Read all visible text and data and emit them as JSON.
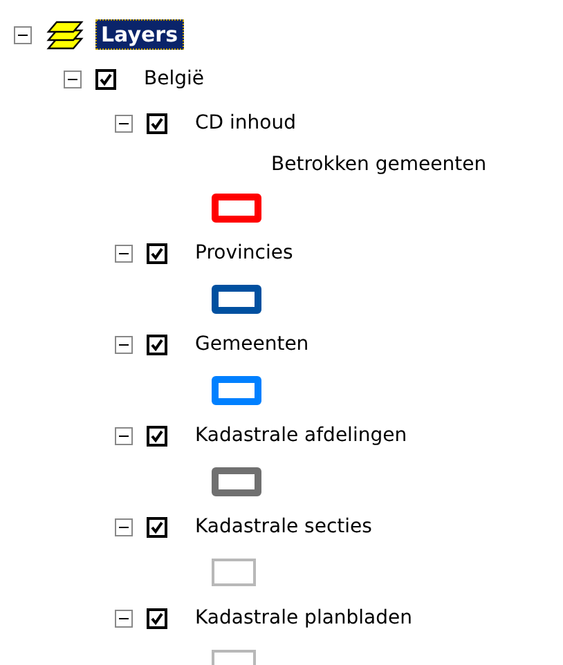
{
  "root": {
    "label": "Layers",
    "expanded": true,
    "selected": true,
    "children": [
      {
        "label": "België",
        "expanded": true,
        "checked": true,
        "children": [
          {
            "label": "CD inhoud",
            "expanded": true,
            "checked": true,
            "legend": [
              {
                "label": "Betrokken gemeenten",
                "color": "#ff0000",
                "kind": "thick"
              }
            ]
          },
          {
            "label": "Provincies",
            "expanded": true,
            "checked": true,
            "legend": [
              {
                "color": "#0050a0",
                "kind": "thick"
              }
            ]
          },
          {
            "label": "Gemeenten",
            "expanded": true,
            "checked": true,
            "legend": [
              {
                "color": "#0080ff",
                "kind": "thick"
              }
            ]
          },
          {
            "label": "Kadastrale afdelingen",
            "expanded": true,
            "checked": true,
            "legend": [
              {
                "color": "#707070",
                "kind": "thick"
              }
            ]
          },
          {
            "label": "Kadastrale secties",
            "expanded": true,
            "checked": true,
            "legend": [
              {
                "color": "#b8b8b8",
                "kind": "thin"
              }
            ]
          },
          {
            "label": "Kadastrale planbladen",
            "expanded": true,
            "checked": true,
            "legend": [
              {
                "color": "#b8b8b8",
                "kind": "thin"
              }
            ]
          }
        ]
      }
    ]
  }
}
